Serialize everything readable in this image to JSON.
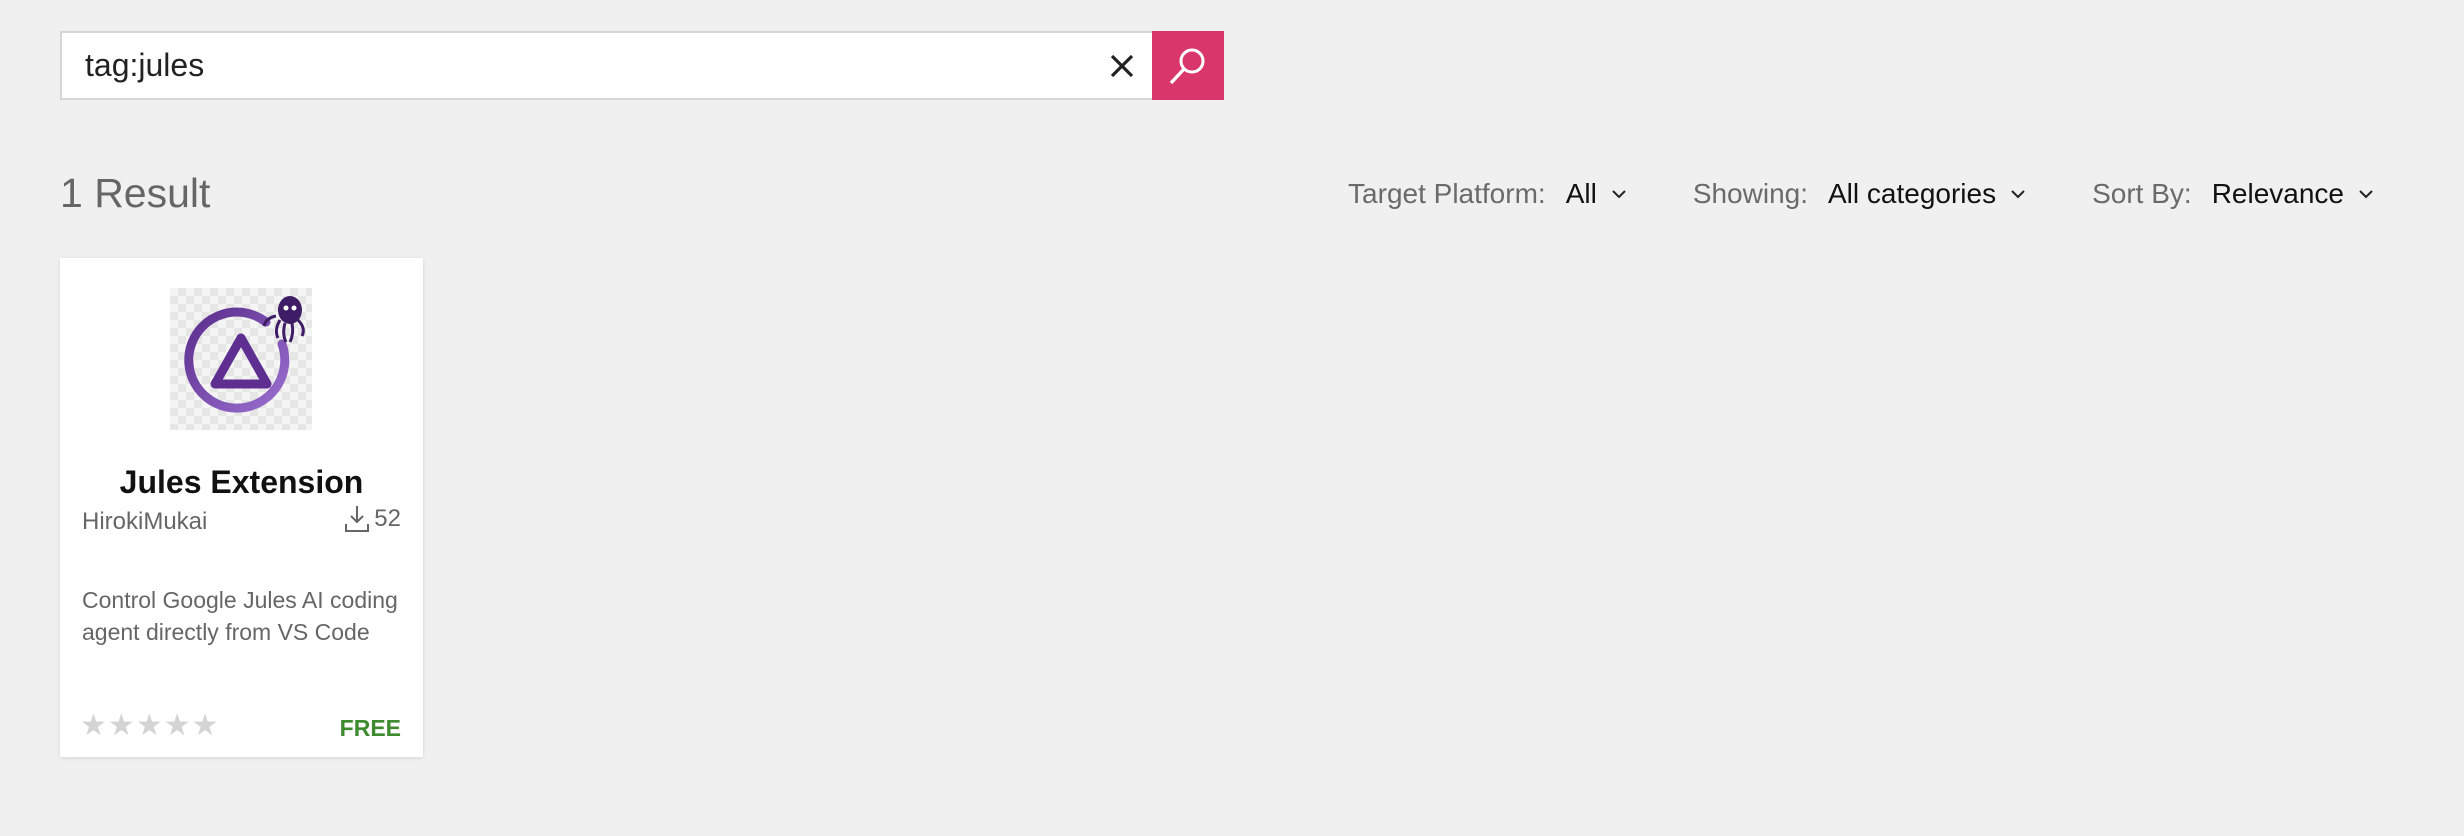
{
  "search": {
    "value": "tag:jules",
    "placeholder": "",
    "accent_color": "#d9376b"
  },
  "results": {
    "count_label": "1 Result"
  },
  "filters": [
    {
      "label": "Target Platform:",
      "value": "All"
    },
    {
      "label": "Showing:",
      "value": "All categories"
    },
    {
      "label": "Sort By:",
      "value": "Relevance"
    }
  ],
  "card": {
    "title": "Jules Extension",
    "publisher": "HirokiMukai",
    "installs": "52",
    "description": "Control Google Jules AI coding agent directly from VS Code",
    "rating": 0,
    "rating_max": 5,
    "price": "FREE",
    "price_color": "#3e8a2e",
    "logo_color": "#6b3fa0"
  }
}
